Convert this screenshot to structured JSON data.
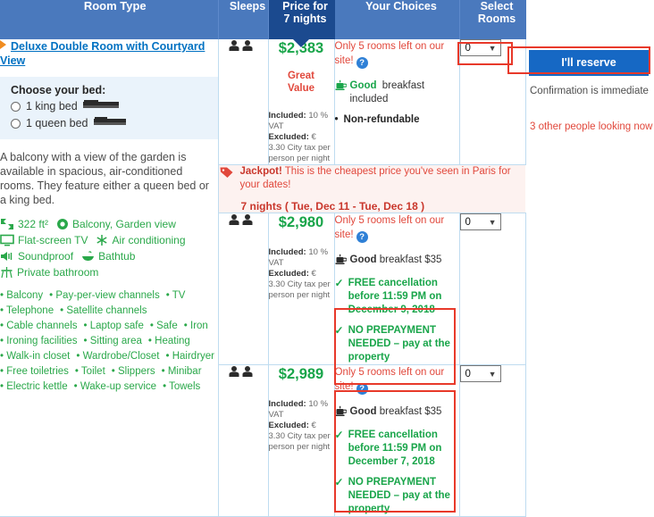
{
  "table": {
    "headers": {
      "room_type": "Room Type",
      "sleeps": "Sleeps",
      "price": "Price for 7 nights",
      "price_line1": "Price for",
      "price_line2": "7 nights",
      "choices": "Your Choices",
      "select_line1": "Select",
      "select_line2": "Rooms"
    }
  },
  "room": {
    "title": "Deluxe Double Room with Courtyard View",
    "bed_chooser": {
      "label": "Choose your bed:",
      "options": [
        {
          "label": "1 king bed",
          "selected": false
        },
        {
          "label": "1 queen bed",
          "selected": false
        }
      ]
    },
    "description": "A balcony with a view of the garden is available in spacious, air-conditioned rooms. They feature either a queen bed or a king bed.",
    "features": [
      {
        "icon": "size-icon",
        "label": "322 ft²"
      },
      {
        "icon": "view-icon",
        "label": "Balcony, Garden view"
      },
      {
        "icon": "tv-icon",
        "label": "Flat-screen TV"
      },
      {
        "icon": "air-conditioning-icon",
        "label": "Air conditioning"
      },
      {
        "icon": "soundproof-icon",
        "label": "Soundproof"
      },
      {
        "icon": "bathtub-icon",
        "label": "Bathtub"
      },
      {
        "icon": "private-bathroom-icon",
        "label": "Private bathroom"
      }
    ],
    "amenity_lines": [
      [
        "Balcony",
        "Pay-per-view channels",
        "TV"
      ],
      [
        "Telephone",
        "Satellite channels"
      ],
      [
        "Cable channels",
        "Laptop safe",
        "Safe",
        "Iron"
      ],
      [
        "Ironing facilities",
        "Sitting area",
        "Heating"
      ],
      [
        "Walk-in closet",
        "Wardrobe/Closet",
        "Hairdryer"
      ],
      [
        "Free toiletries",
        "Toilet",
        "Slippers",
        "Minibar"
      ],
      [
        "Electric kettle",
        "Wake-up service",
        "Towels"
      ]
    ]
  },
  "tax_note": {
    "included_label": "Included:",
    "included_value": "10 % VAT",
    "excluded_label": "Excluded:",
    "excluded_value": "€ 3.30 City tax per person per night"
  },
  "rows": [
    {
      "sleeps": 2,
      "price": "$2,383",
      "badge": "Great Value",
      "rooms_left": "Only 5 rooms left on our site!",
      "breakfast_strong": "Good",
      "breakfast_rest": " breakfast included",
      "non_refundable": "Non-refundable",
      "select_value": "0"
    },
    {
      "sleeps": 2,
      "price": "$2,980",
      "rooms_left": "Only 5 rooms left on our site!",
      "breakfast_strong": "Good",
      "breakfast_rest": " breakfast $35",
      "cancellation": "FREE cancellation before 11:59 PM on December 9, 2018",
      "prepayment": "NO PREPAYMENT NEEDED – pay at the property",
      "select_value": "0"
    },
    {
      "sleeps": 2,
      "price": "$2,989",
      "rooms_left": "Only 5 rooms left on our site!",
      "breakfast_strong": "Good",
      "breakfast_rest": " breakfast $35",
      "cancellation": "FREE cancellation before 11:59 PM on December 7, 2018",
      "prepayment": "NO PREPAYMENT NEEDED – pay at the property",
      "select_value": "0"
    }
  ],
  "jackpot": {
    "strong": "Jackpot!",
    "text": " This is the cheapest price you've seen in Paris for your dates!",
    "dates": "7 nights ( Tue, Dec 11 - Tue, Dec 18 )"
  },
  "reserve_panel": {
    "button": "I'll reserve",
    "confirmation": "Confirmation is immediate",
    "looking": "3 other people looking now"
  },
  "colors": {
    "header_blue": "#4a79bd",
    "price_header_blue": "#1b4a8f",
    "link_blue": "#0071c2",
    "green": "#19a54a",
    "red": "#e1483c",
    "highlight_red": "#e8392a",
    "button_blue": "#1668c4"
  }
}
